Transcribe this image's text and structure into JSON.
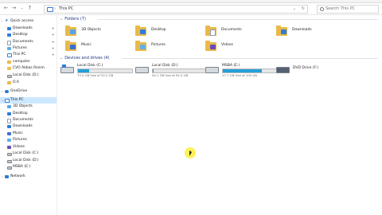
{
  "window": {
    "title_strip": [
      "...",
      "...",
      "..."
    ],
    "address": {
      "location": "This PC",
      "search_placeholder": "Search This PC"
    }
  },
  "sidebar": {
    "quick_access": "Quick access",
    "items": [
      {
        "label": "Downloads",
        "icon": "downloads-icon",
        "pinned": true
      },
      {
        "label": "Desktop",
        "icon": "desktop-icon",
        "pinned": true
      },
      {
        "label": "Documents",
        "icon": "documents-icon",
        "pinned": true
      },
      {
        "label": "Pictures",
        "icon": "pictures-icon",
        "pinned": true
      },
      {
        "label": "This PC",
        "icon": "pc-icon",
        "pinned": true
      },
      {
        "label": "computer",
        "icon": "folder-icon",
        "pinned": false
      },
      {
        "label": "CVO Akbas Resim",
        "icon": "folder-icon",
        "pinned": false
      },
      {
        "label": "Local Disk (D:)",
        "icon": "drive-icon",
        "pinned": false
      },
      {
        "label": "O.X",
        "icon": "folder-icon",
        "pinned": false
      }
    ],
    "onedrive": "OneDrive",
    "this_pc": "This PC",
    "pc_items": [
      {
        "label": "3D Objects",
        "icon": "3d-objects-icon"
      },
      {
        "label": "Desktop",
        "icon": "desktop-icon"
      },
      {
        "label": "Documents",
        "icon": "documents-icon"
      },
      {
        "label": "Downloads",
        "icon": "downloads-icon"
      },
      {
        "label": "Music",
        "icon": "music-icon"
      },
      {
        "label": "Pictures",
        "icon": "pictures-icon"
      },
      {
        "label": "Videos",
        "icon": "videos-icon"
      },
      {
        "label": "Local Disk (C:)",
        "icon": "drive-icon"
      },
      {
        "label": "Local Disk (D:)",
        "icon": "drive-icon"
      },
      {
        "label": "MSBA (E:)",
        "icon": "drive-icon"
      }
    ],
    "network": "Network"
  },
  "main": {
    "folders_header": "Folders (7)",
    "folders": [
      {
        "label": "3D Objects",
        "icon": "3d-objects-icon"
      },
      {
        "label": "Desktop",
        "icon": "desktop-icon"
      },
      {
        "label": "Documents",
        "icon": "documents-icon"
      },
      {
        "label": "Downloads",
        "icon": "downloads-icon"
      },
      {
        "label": "Music",
        "icon": "music-icon"
      },
      {
        "label": "Pictures",
        "icon": "pictures-icon"
      },
      {
        "label": "Videos",
        "icon": "videos-icon"
      }
    ],
    "drives_header": "Devices and drives (4)",
    "drives": [
      {
        "label": "Local Disk (C:)",
        "free": "73.5 GB free of 92.2 GB",
        "used_fraction": 0.2
      },
      {
        "label": "Local Disk (D:)",
        "free": "94.1 GB free of 92.4 GB",
        "used_fraction": 0.02
      },
      {
        "label": "MSBA (E:)",
        "free": "27.7 GB free of 100 GB",
        "used_fraction": 0.72
      },
      {
        "label": "DVD Drive (F:)",
        "free": "",
        "used_fraction": null
      }
    ]
  },
  "colors": {
    "accent": "#26a0da",
    "selection": "#cce8ff",
    "header_text": "#1e3287",
    "folder": "#e9b949",
    "cursor_highlight": "#ffee3c"
  }
}
